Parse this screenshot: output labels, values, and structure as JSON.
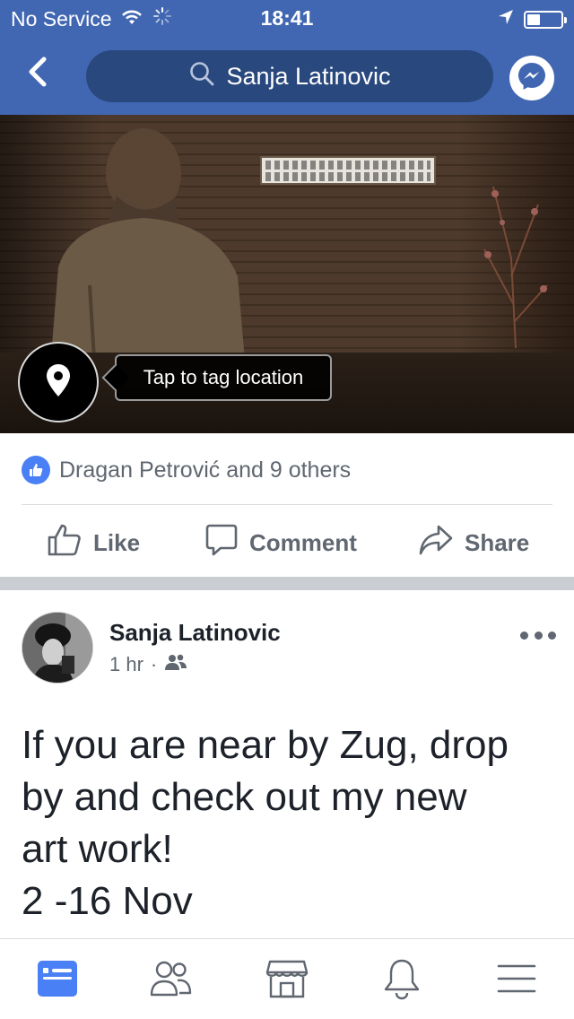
{
  "status_bar": {
    "carrier": "No Service",
    "time": "18:41",
    "icons": [
      "wifi-icon",
      "activity-spinner-icon",
      "location-arrow-icon",
      "battery-icon"
    ]
  },
  "nav": {
    "search_text": "Sanja Latinovic",
    "icons": [
      "chevron-left-icon",
      "search-icon",
      "messenger-icon"
    ]
  },
  "photo": {
    "tag_tooltip": "Tap to tag location"
  },
  "reactions": {
    "text": "Dragan Petrović and 9 others"
  },
  "actions": {
    "like": "Like",
    "comment": "Comment",
    "share": "Share"
  },
  "post": {
    "author": "Sanja Latinovic",
    "time": "1 hr",
    "separator": "·",
    "audience_icon": "friends-icon",
    "text": "If you are near by Zug, drop\nby and check out my new\nart work!\n2 -16 Nov"
  },
  "tabbar": {
    "tabs": [
      "news-feed-icon",
      "friends-icon",
      "marketplace-icon",
      "notifications-icon",
      "menu-icon"
    ],
    "active": "news-feed-icon",
    "active_color": "#4267b2",
    "inactive_color": "#606770"
  },
  "colors": {
    "brand": "#4267b2",
    "like_blue": "#4a80f5"
  }
}
